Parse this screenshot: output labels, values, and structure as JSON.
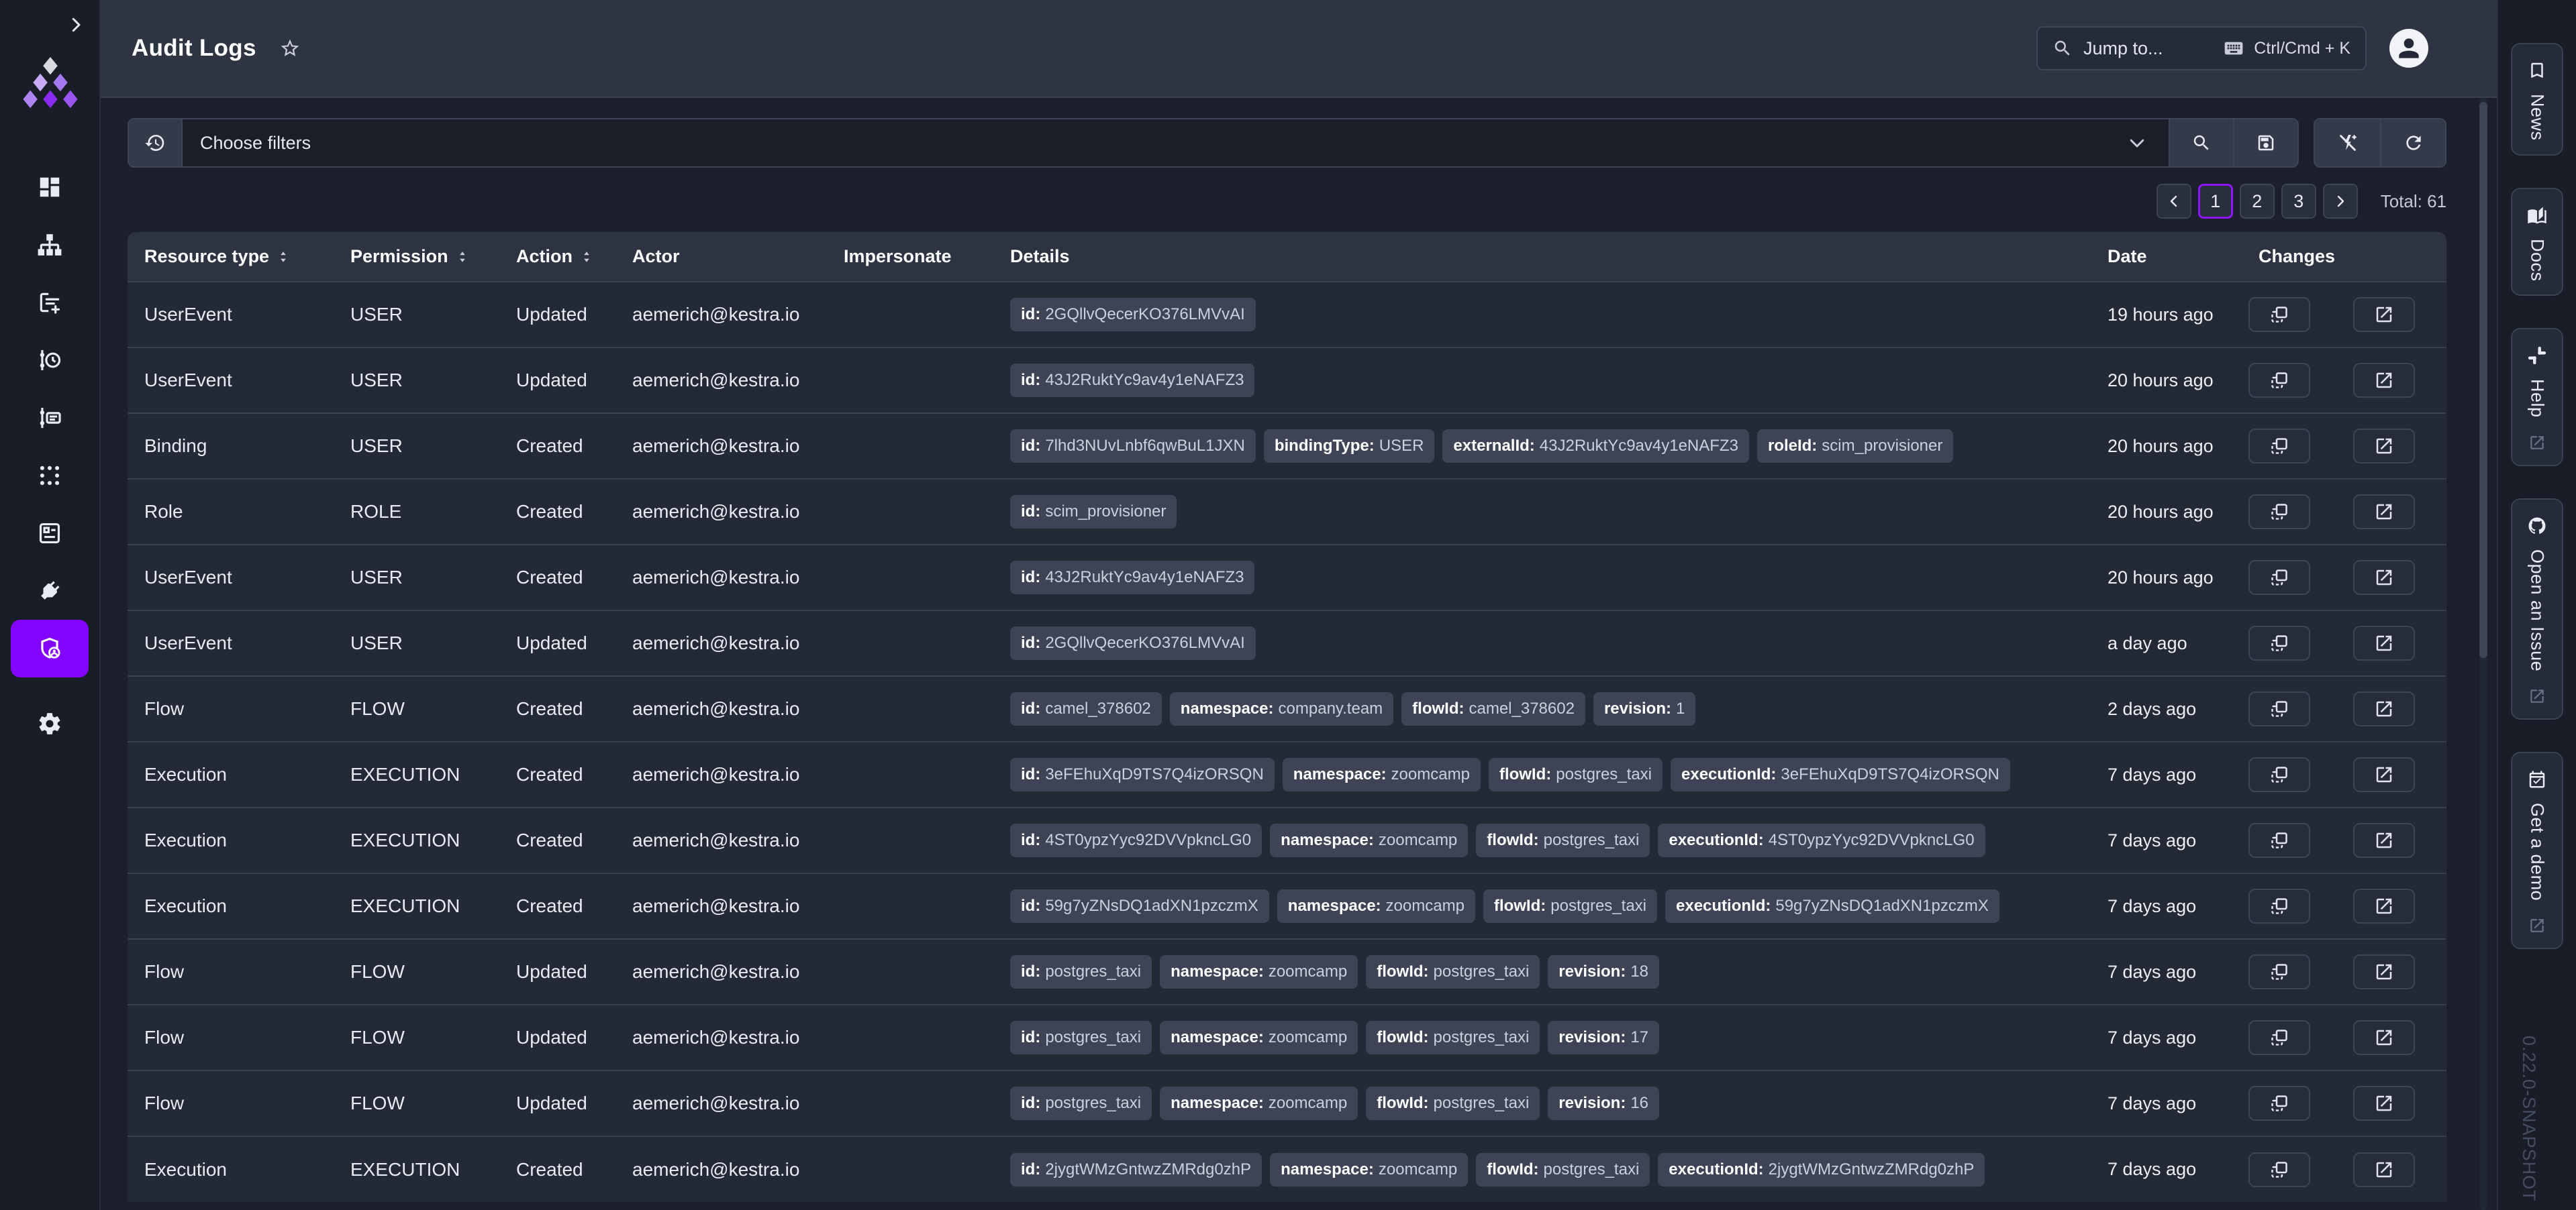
{
  "topbar": {
    "title": "Audit Logs",
    "search": {
      "placeholder": "Jump to...",
      "shortcut": "Ctrl/Cmd + K"
    }
  },
  "sidebar": {
    "active": "administration",
    "items": [
      {
        "id": "home",
        "icon": "view-dashboard"
      },
      {
        "id": "flows",
        "icon": "sitemap"
      },
      {
        "id": "editor",
        "icon": "text-box-plus"
      },
      {
        "id": "executions",
        "icon": "timeline-clock"
      },
      {
        "id": "logs",
        "icon": "timeline-text"
      },
      {
        "id": "apps",
        "icon": "dots-grid"
      },
      {
        "id": "blueprints",
        "icon": "ballot"
      },
      {
        "id": "plugins",
        "icon": "power-plug"
      },
      {
        "id": "administration",
        "icon": "shield-account"
      },
      {
        "id": "settings",
        "icon": "cog"
      }
    ]
  },
  "filter": {
    "placeholder": "Choose filters"
  },
  "pagination": {
    "pages": [
      "1",
      "2",
      "3"
    ],
    "active": "1",
    "total": "Total: 61"
  },
  "table": {
    "columns": [
      {
        "label": "Resource type",
        "sortable": true
      },
      {
        "label": "Permission",
        "sortable": true
      },
      {
        "label": "Action",
        "sortable": true
      },
      {
        "label": "Actor",
        "sortable": false
      },
      {
        "label": "Impersonate",
        "sortable": false
      },
      {
        "label": "Details",
        "sortable": false
      },
      {
        "label": "Date",
        "sortable": false
      },
      {
        "label": "Changes",
        "sortable": false
      }
    ],
    "rows": [
      {
        "resource_type": "UserEvent",
        "permission": "USER",
        "action": "Updated",
        "actor": "aemerich@kestra.io",
        "impersonate": "",
        "details": [
          {
            "key": "id",
            "value": "2GQllvQecerKO376LMVvAI"
          }
        ],
        "date": "19 hours ago"
      },
      {
        "resource_type": "UserEvent",
        "permission": "USER",
        "action": "Updated",
        "actor": "aemerich@kestra.io",
        "impersonate": "",
        "details": [
          {
            "key": "id",
            "value": "43J2RuktYc9av4y1eNAFZ3"
          }
        ],
        "date": "20 hours ago"
      },
      {
        "resource_type": "Binding",
        "permission": "USER",
        "action": "Created",
        "actor": "aemerich@kestra.io",
        "impersonate": "",
        "details": [
          {
            "key": "id",
            "value": "7lhd3NUvLnbf6qwBuL1JXN"
          },
          {
            "key": "bindingType",
            "value": "USER"
          },
          {
            "key": "externalId",
            "value": "43J2RuktYc9av4y1eNAFZ3"
          },
          {
            "key": "roleId",
            "value": "scim_provisioner"
          }
        ],
        "date": "20 hours ago"
      },
      {
        "resource_type": "Role",
        "permission": "ROLE",
        "action": "Created",
        "actor": "aemerich@kestra.io",
        "impersonate": "",
        "details": [
          {
            "key": "id",
            "value": "scim_provisioner"
          }
        ],
        "date": "20 hours ago"
      },
      {
        "resource_type": "UserEvent",
        "permission": "USER",
        "action": "Created",
        "actor": "aemerich@kestra.io",
        "impersonate": "",
        "details": [
          {
            "key": "id",
            "value": "43J2RuktYc9av4y1eNAFZ3"
          }
        ],
        "date": "20 hours ago"
      },
      {
        "resource_type": "UserEvent",
        "permission": "USER",
        "action": "Updated",
        "actor": "aemerich@kestra.io",
        "impersonate": "",
        "details": [
          {
            "key": "id",
            "value": "2GQllvQecerKO376LMVvAI"
          }
        ],
        "date": "a day ago"
      },
      {
        "resource_type": "Flow",
        "permission": "FLOW",
        "action": "Created",
        "actor": "aemerich@kestra.io",
        "impersonate": "",
        "details": [
          {
            "key": "id",
            "value": "camel_378602"
          },
          {
            "key": "namespace",
            "value": "company.team"
          },
          {
            "key": "flowId",
            "value": "camel_378602"
          },
          {
            "key": "revision",
            "value": "1"
          }
        ],
        "date": "2 days ago"
      },
      {
        "resource_type": "Execution",
        "permission": "EXECUTION",
        "action": "Created",
        "actor": "aemerich@kestra.io",
        "impersonate": "",
        "details": [
          {
            "key": "id",
            "value": "3eFEhuXqD9TS7Q4izORSQN"
          },
          {
            "key": "namespace",
            "value": "zoomcamp"
          },
          {
            "key": "flowId",
            "value": "postgres_taxi"
          },
          {
            "key": "executionId",
            "value": "3eFEhuXqD9TS7Q4izORSQN"
          }
        ],
        "date": "7 days ago"
      },
      {
        "resource_type": "Execution",
        "permission": "EXECUTION",
        "action": "Created",
        "actor": "aemerich@kestra.io",
        "impersonate": "",
        "details": [
          {
            "key": "id",
            "value": "4ST0ypzYyc92DVVpkncLG0"
          },
          {
            "key": "namespace",
            "value": "zoomcamp"
          },
          {
            "key": "flowId",
            "value": "postgres_taxi"
          },
          {
            "key": "executionId",
            "value": "4ST0ypzYyc92DVVpkncLG0"
          }
        ],
        "date": "7 days ago"
      },
      {
        "resource_type": "Execution",
        "permission": "EXECUTION",
        "action": "Created",
        "actor": "aemerich@kestra.io",
        "impersonate": "",
        "details": [
          {
            "key": "id",
            "value": "59g7yZNsDQ1adXN1pzczmX"
          },
          {
            "key": "namespace",
            "value": "zoomcamp"
          },
          {
            "key": "flowId",
            "value": "postgres_taxi"
          },
          {
            "key": "executionId",
            "value": "59g7yZNsDQ1adXN1pzczmX"
          }
        ],
        "date": "7 days ago"
      },
      {
        "resource_type": "Flow",
        "permission": "FLOW",
        "action": "Updated",
        "actor": "aemerich@kestra.io",
        "impersonate": "",
        "details": [
          {
            "key": "id",
            "value": "postgres_taxi"
          },
          {
            "key": "namespace",
            "value": "zoomcamp"
          },
          {
            "key": "flowId",
            "value": "postgres_taxi"
          },
          {
            "key": "revision",
            "value": "18"
          }
        ],
        "date": "7 days ago"
      },
      {
        "resource_type": "Flow",
        "permission": "FLOW",
        "action": "Updated",
        "actor": "aemerich@kestra.io",
        "impersonate": "",
        "details": [
          {
            "key": "id",
            "value": "postgres_taxi"
          },
          {
            "key": "namespace",
            "value": "zoomcamp"
          },
          {
            "key": "flowId",
            "value": "postgres_taxi"
          },
          {
            "key": "revision",
            "value": "17"
          }
        ],
        "date": "7 days ago"
      },
      {
        "resource_type": "Flow",
        "permission": "FLOW",
        "action": "Updated",
        "actor": "aemerich@kestra.io",
        "impersonate": "",
        "details": [
          {
            "key": "id",
            "value": "postgres_taxi"
          },
          {
            "key": "namespace",
            "value": "zoomcamp"
          },
          {
            "key": "flowId",
            "value": "postgres_taxi"
          },
          {
            "key": "revision",
            "value": "16"
          }
        ],
        "date": "7 days ago"
      },
      {
        "resource_type": "Execution",
        "permission": "EXECUTION",
        "action": "Created",
        "actor": "aemerich@kestra.io",
        "impersonate": "",
        "details": [
          {
            "key": "id",
            "value": "2jygtWMzGntwzZMRdg0zhP"
          },
          {
            "key": "namespace",
            "value": "zoomcamp"
          },
          {
            "key": "flowId",
            "value": "postgres_taxi"
          },
          {
            "key": "executionId",
            "value": "2jygtWMzGntwzZMRdg0zhP"
          }
        ],
        "date": "7 days ago"
      }
    ]
  },
  "rail": {
    "tabs": [
      {
        "id": "news",
        "label": "News",
        "icon": "bookmark",
        "external": false
      },
      {
        "id": "docs",
        "label": "Docs",
        "icon": "book",
        "external": false
      },
      {
        "id": "help",
        "label": "Help",
        "icon": "slack",
        "external": true
      },
      {
        "id": "open-an-issue",
        "label": "Open an Issue",
        "icon": "github",
        "external": true
      },
      {
        "id": "get-a-demo",
        "label": "Get a demo",
        "icon": "calendar-check",
        "external": true
      }
    ],
    "version": "0.22.0-SNAPSHOT"
  },
  "colors": {
    "accent_purple": "#8405FF",
    "active_page_border": "#8E15FF",
    "topbar_bg": "#2F3443",
    "page_bg": "#1B202C",
    "row_bg": "#242936",
    "badge_bg": "#3E4456"
  }
}
